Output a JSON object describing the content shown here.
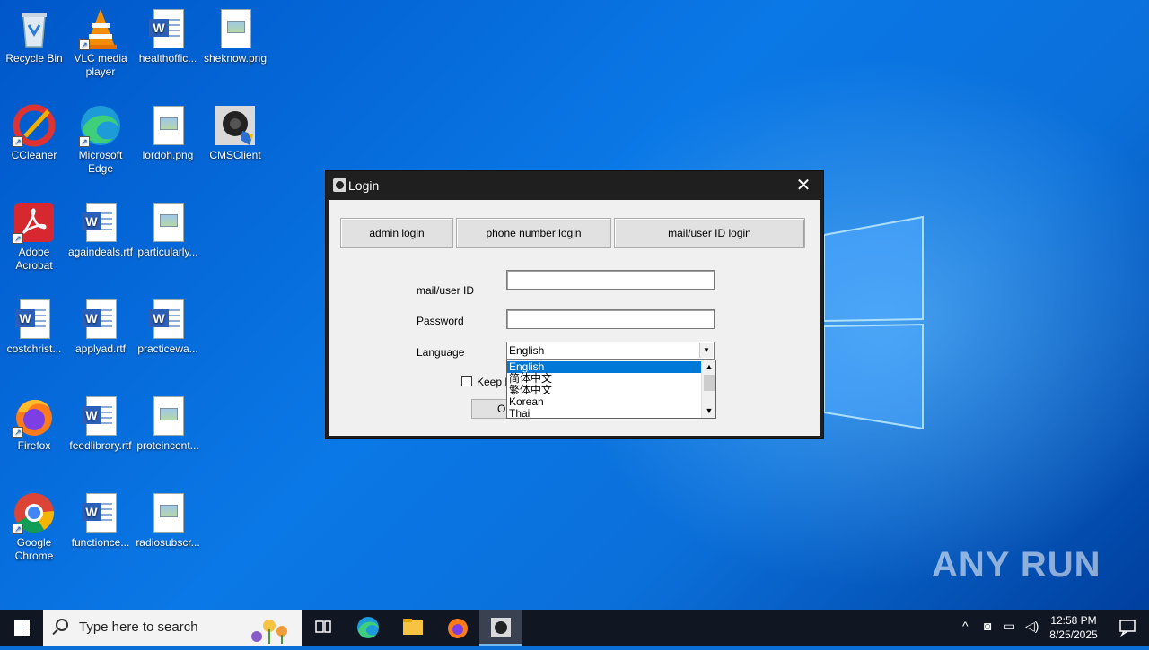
{
  "desktop": {
    "icons": [
      {
        "label": "Recycle Bin",
        "icon": "recycle-bin-icon"
      },
      {
        "label": "VLC media player",
        "icon": "vlc-icon"
      },
      {
        "label": "healthoffic...",
        "icon": "word-doc-icon"
      },
      {
        "label": "sheknow.png",
        "icon": "image-file-icon"
      },
      {
        "label": "CCleaner",
        "icon": "ccleaner-icon"
      },
      {
        "label": "Microsoft Edge",
        "icon": "edge-icon"
      },
      {
        "label": "lordoh.png",
        "icon": "image-file-icon"
      },
      {
        "label": "CMSClient",
        "icon": "cmsclient-icon"
      },
      {
        "label": "Adobe Acrobat",
        "icon": "acrobat-icon"
      },
      {
        "label": "againdeals.rtf",
        "icon": "word-doc-icon"
      },
      {
        "label": "particularly...",
        "icon": "image-file-icon"
      },
      {
        "label": "costchrist...",
        "icon": "word-doc-icon"
      },
      {
        "label": "applyad.rtf",
        "icon": "word-doc-icon"
      },
      {
        "label": "practicewa...",
        "icon": "word-doc-icon"
      },
      {
        "label": "Firefox",
        "icon": "firefox-icon"
      },
      {
        "label": "feedlibrary.rtf",
        "icon": "word-doc-icon"
      },
      {
        "label": "proteincent...",
        "icon": "image-file-icon"
      },
      {
        "label": "Google Chrome",
        "icon": "chrome-icon"
      },
      {
        "label": "functionce...",
        "icon": "word-doc-icon"
      },
      {
        "label": "radiosubscr...",
        "icon": "image-file-icon"
      }
    ],
    "watermark": "ANY RUN"
  },
  "login": {
    "title": "Login",
    "tabs": [
      "admin login",
      "phone number login",
      "mail/user ID login"
    ],
    "mail_label": "mail/user ID",
    "mail_value": "",
    "password_label": "Password",
    "password_value": "",
    "language_label": "Language",
    "language_selected": "English",
    "language_options": [
      "English",
      "简体中文",
      "繁体中文",
      "Korean",
      "Thai"
    ],
    "keep_label": "Keep P",
    "ok_label": "O"
  },
  "taskbar": {
    "search_placeholder": "Type here to search",
    "time": "12:58 PM",
    "date": "8/25/2025"
  },
  "colors": {
    "selection": "#0078d7",
    "taskbar": "#101722"
  }
}
